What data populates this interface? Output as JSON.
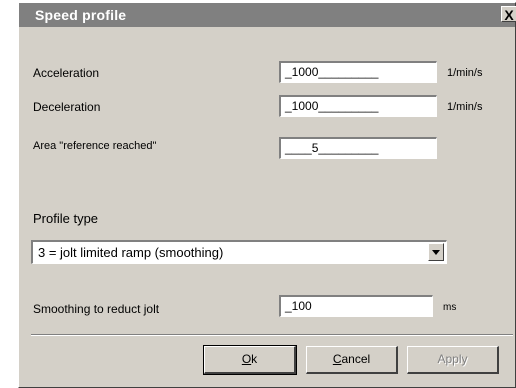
{
  "window": {
    "title": "Speed profile",
    "close_label": "X"
  },
  "fields": {
    "acceleration": {
      "label": "Acceleration",
      "value": "_1000_________",
      "unit": "1/min/s"
    },
    "deceleration": {
      "label": "Deceleration",
      "value": "_1000_________",
      "unit": "1/min/s"
    },
    "area_reference_reached": {
      "label": "Area \"reference reached\"",
      "value": "____5_________",
      "unit": ""
    },
    "smoothing": {
      "label": "Smoothing to reduct jolt",
      "value": "_100",
      "unit": "ms"
    }
  },
  "profile_type": {
    "label": "Profile type",
    "selected": "3 = jolt limited ramp (smoothing)"
  },
  "buttons": {
    "ok": {
      "mnemonic": "O",
      "rest": "k"
    },
    "cancel": {
      "mnemonic": "C",
      "rest": "ancel"
    },
    "apply": {
      "label": "Apply",
      "enabled": false
    }
  }
}
